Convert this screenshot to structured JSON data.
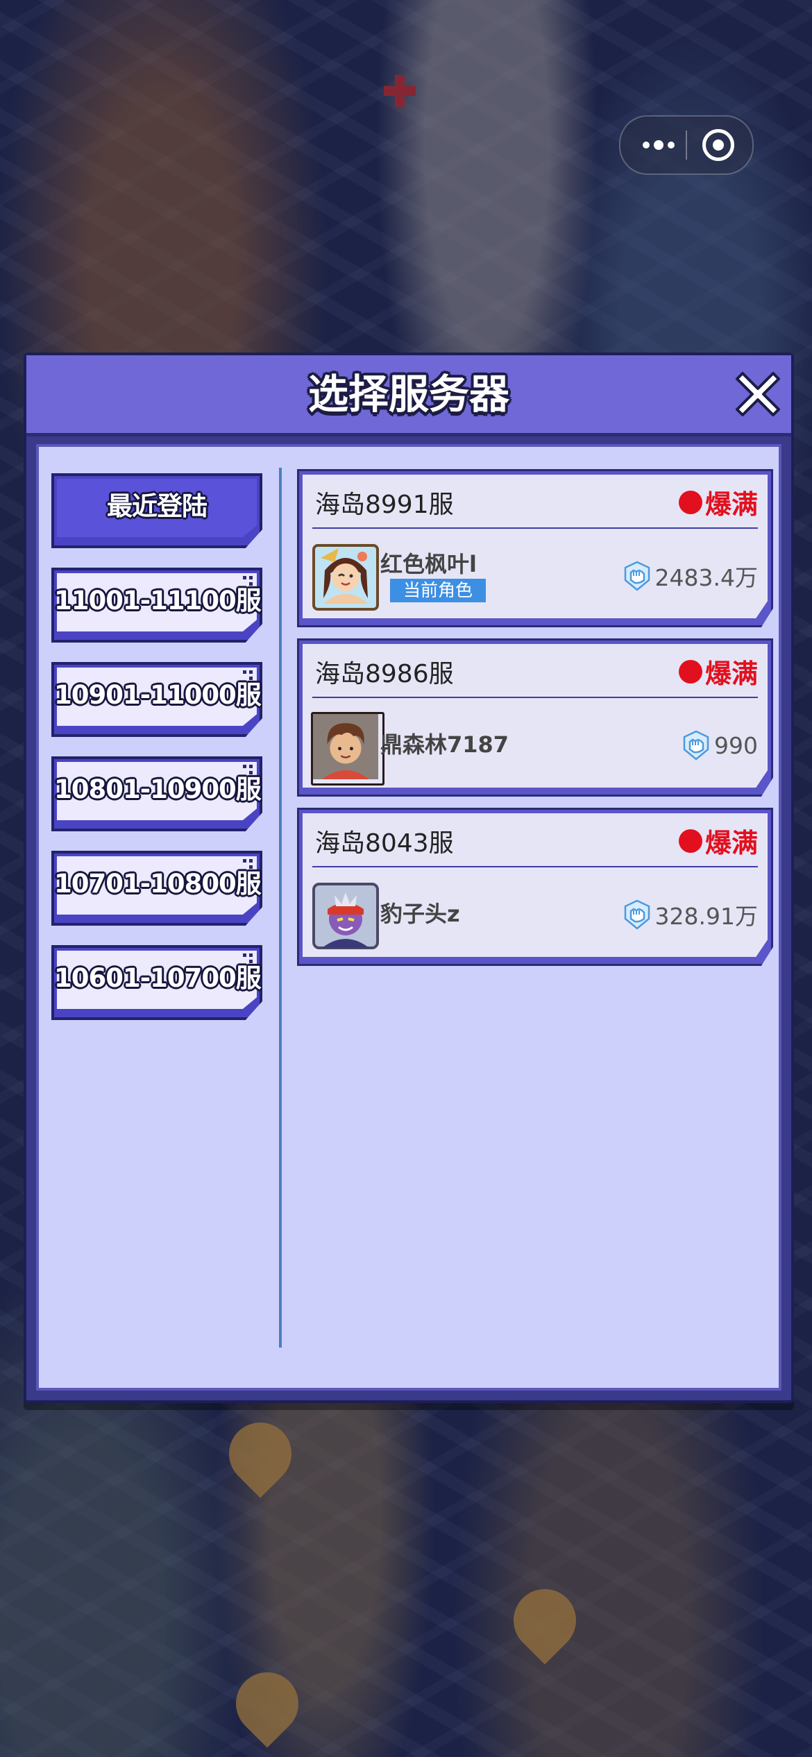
{
  "dialog": {
    "title": "选择服务器"
  },
  "groups": [
    {
      "label": "最近登陆",
      "active": true
    },
    {
      "label": "11001-11100服",
      "active": false
    },
    {
      "label": "10901-11000服",
      "active": false
    },
    {
      "label": "10801-10900服",
      "active": false
    },
    {
      "label": "10701-10800服",
      "active": false
    },
    {
      "label": "10601-10700服",
      "active": false
    }
  ],
  "servers": [
    {
      "name": "海岛8991服",
      "status": "爆满",
      "player": "红色枫叶l",
      "badge": "当前角色",
      "power": "2483.4万",
      "avatar_icon": "girl-avatar-icon"
    },
    {
      "name": "海岛8986服",
      "status": "爆满",
      "player": "鼎森林7187",
      "power": "990",
      "avatar_icon": "boy-avatar-icon"
    },
    {
      "name": "海岛8043服",
      "status": "爆满",
      "player": "豹子头z",
      "power": "328.91万",
      "avatar_icon": "purple-warrior-avatar-icon"
    }
  ],
  "colors": {
    "header": "#6f68d6",
    "panel": "#cdd0fb",
    "status_red": "#e2101e",
    "badge_blue": "#3d8fe4"
  }
}
